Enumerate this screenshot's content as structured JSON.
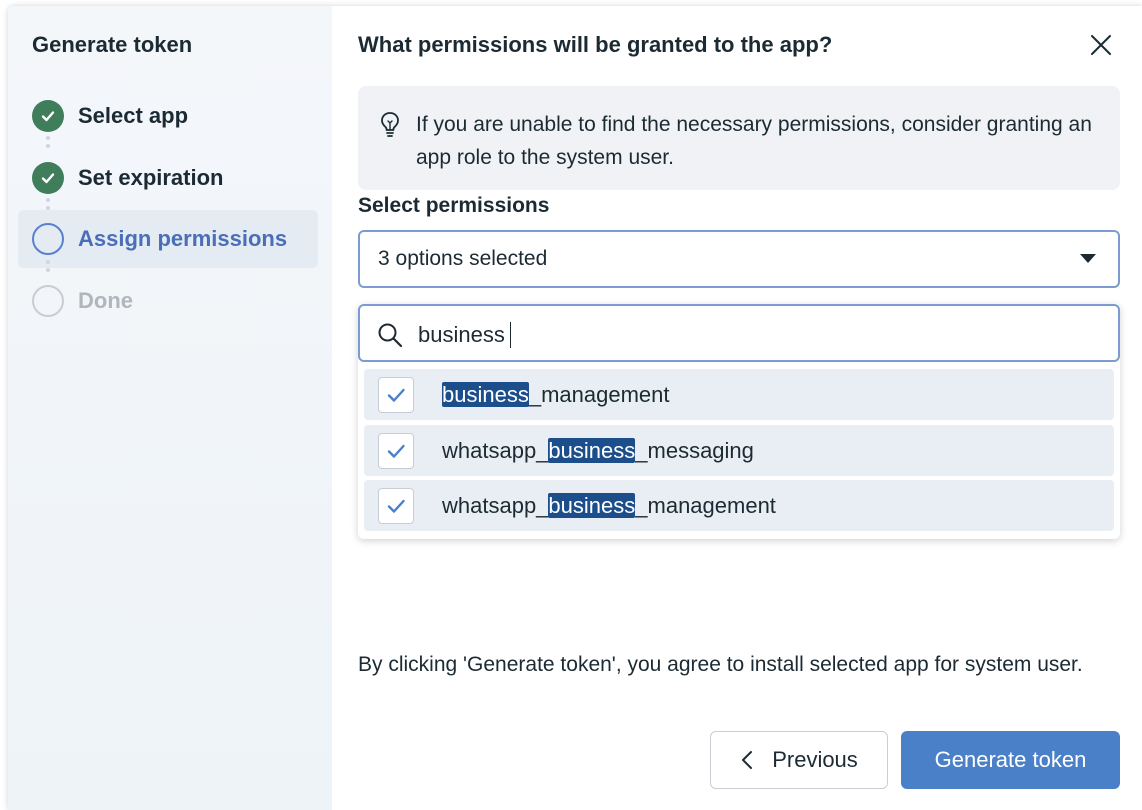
{
  "sidebar": {
    "title": "Generate token",
    "steps": [
      {
        "label": "Select app",
        "state": "done"
      },
      {
        "label": "Set expiration",
        "state": "done"
      },
      {
        "label": "Assign permissions",
        "state": "current"
      },
      {
        "label": "Done",
        "state": "pending"
      }
    ]
  },
  "main": {
    "title": "What permissions will be granted to the app?",
    "info_text": "If you are unable to find the necessary permissions, consider granting an app role to the system user.",
    "permissions_label": "Select permissions",
    "select_value": "3 options selected",
    "search": {
      "value": "business"
    },
    "options": [
      {
        "parts": [
          "",
          "business",
          "_management"
        ],
        "checked": true
      },
      {
        "parts": [
          "whatsapp_",
          "business",
          "_messaging"
        ],
        "checked": true
      },
      {
        "parts": [
          "whatsapp_",
          "business",
          "_management"
        ],
        "checked": true
      }
    ],
    "agreement": "By clicking 'Generate token', you agree to install selected app for system user."
  },
  "buttons": {
    "previous": "Previous",
    "generate": "Generate token"
  },
  "colors": {
    "accent": "#4a80c8",
    "done_green": "#3f7d5b",
    "highlight": "#1c4e8c"
  }
}
